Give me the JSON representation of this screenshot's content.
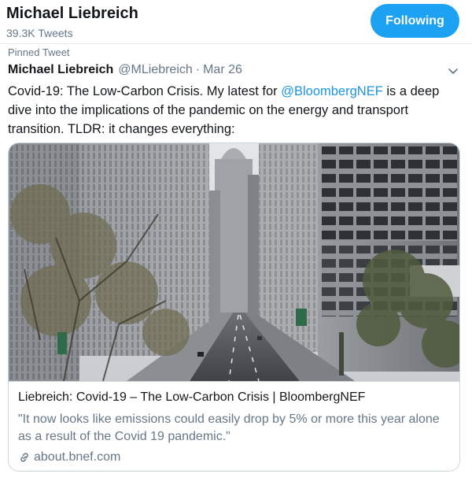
{
  "profile": {
    "name": "Michael Liebreich",
    "tweet_count": "39.3K Tweets",
    "follow_button": "Following"
  },
  "tweet": {
    "pinned_label": "Pinned Tweet",
    "author_name": "Michael Liebreich",
    "author_handle": "@MLiebreich",
    "separator": "·",
    "date": "Mar 26",
    "text_before_mention": "Covid-19: The Low-Carbon Crisis. My latest for ",
    "mention": "@BloombergNEF",
    "text_after_mention": " is a deep dive into the implications of the pandemic on the energy and transport transition. TLDR: it changes everything:",
    "menu_icon": "chevron-down-icon"
  },
  "card": {
    "image_icon": "city-street-photo",
    "title": "Liebreich: Covid-19 – The Low-Carbon Crisis | BloombergNEF",
    "description": "\"It now looks like emissions could easily drop by 5% or more this year alone as a result of the Covid 19 pandemic.\"",
    "domain": "about.bnef.com",
    "link_icon": "link-icon"
  },
  "colors": {
    "accent": "#1da1f2",
    "mention": "#1b95e0",
    "secondary_text": "#657786",
    "border": "#ccd6dd"
  }
}
